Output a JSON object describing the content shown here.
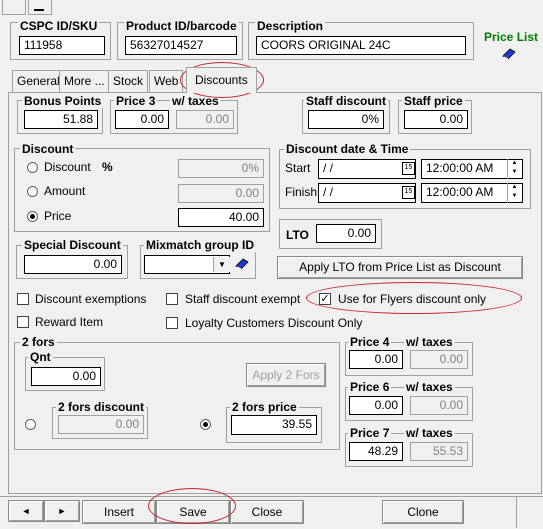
{
  "header": {
    "sku_label": "CSPC ID/SKU",
    "sku_value": "111958",
    "product_label": "Product ID/barcode",
    "product_value": "56327014527",
    "desc_label": "Description",
    "desc_value": "COORS ORIGINAL 24C",
    "price_list_label": "Price List"
  },
  "tabs": [
    "General",
    "More ...",
    "Stock",
    "Web",
    "Discounts"
  ],
  "active_tab": "Discounts",
  "bonus_points": {
    "label": "Bonus Points",
    "value": "51.88"
  },
  "price3": {
    "label": "Price 3",
    "taxes_label": "w/  taxes",
    "value": "0.00",
    "taxes_value": "0.00"
  },
  "staff_discount": {
    "label": "Staff discount",
    "value": "0%"
  },
  "staff_price": {
    "label": "Staff price",
    "value": "0.00"
  },
  "discount": {
    "label": "Discount",
    "opt_discount": "Discount",
    "pct": "%",
    "opt_discount_value": "0%",
    "opt_amount": "Amount",
    "opt_amount_value": "0.00",
    "opt_price": "Price",
    "opt_price_value": "40.00",
    "selected": "Price"
  },
  "discount_dt": {
    "label": "Discount date & Time",
    "start_label": "Start",
    "start_date": "/ /",
    "start_time": "12:00:00 AM",
    "finish_label": "Finish",
    "finish_date": "/ /",
    "finish_time": "12:00:00 AM",
    "cal_day": "15"
  },
  "lto": {
    "label": "LTO",
    "value": "0.00"
  },
  "special_discount": {
    "label": "Special Discount",
    "value": "0.00"
  },
  "mixmatch": {
    "label": "Mixmatch group ID",
    "value": ""
  },
  "apply_lto_label": "Apply LTO from Price List as Discount",
  "checks": {
    "discount_exemptions": {
      "label": "Discount exemptions",
      "checked": false
    },
    "staff_discount_exempt": {
      "label": "Staff discount exempt",
      "checked": false
    },
    "use_for_flyers": {
      "label": "Use for Flyers discount only",
      "checked": true
    },
    "reward_item": {
      "label": "Reward Item",
      "checked": false
    },
    "loyalty_only": {
      "label": "Loyalty Customers Discount Only",
      "checked": false
    }
  },
  "twofors": {
    "label": "2 fors",
    "qnt_label": "Qnt",
    "qnt_value": "0.00",
    "apply_label": "Apply 2 Fors",
    "discount_label": "2 fors discount",
    "discount_value": "0.00",
    "price_label": "2 fors price",
    "price_value": "39.55",
    "selected": "price"
  },
  "price4": {
    "label": "Price 4",
    "taxes_label": "w/  taxes",
    "value": "0.00",
    "taxes_value": "0.00"
  },
  "price6": {
    "label": "Price 6",
    "taxes_label": "w/  taxes",
    "value": "0.00",
    "taxes_value": "0.00"
  },
  "price7": {
    "label": "Price 7",
    "taxes_label": "w/  taxes",
    "value": "48.29",
    "taxes_value": "55.53"
  },
  "footer": {
    "prev": "◄",
    "next": "►",
    "insert": "Insert",
    "save": "Save",
    "close": "Close",
    "clone": "Clone"
  },
  "colors": {
    "annotation": "#c8262a",
    "price_list": "#008000",
    "window_bg": "#f0f0f0"
  }
}
